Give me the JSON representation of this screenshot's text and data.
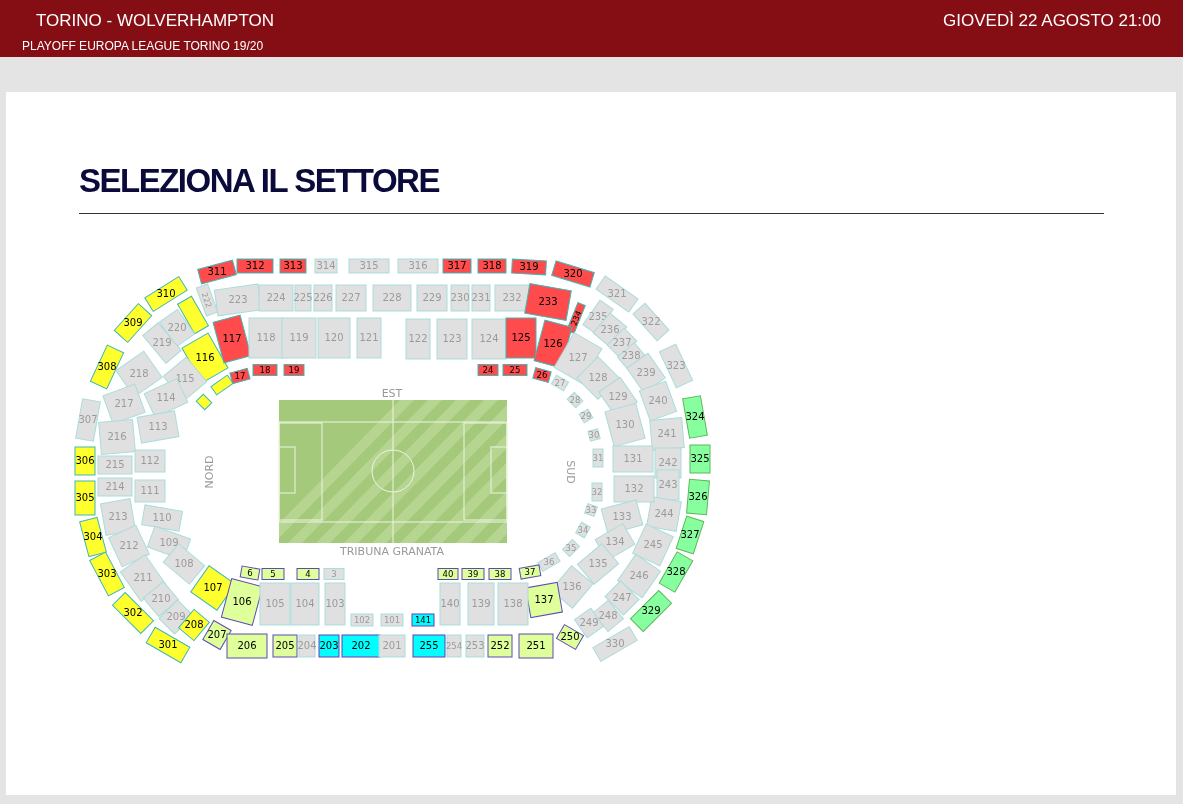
{
  "header": {
    "match": "TORINO - WOLVERHAMPTON",
    "competition": "PLAYOFF EUROPA LEAGUE TORINO 19/20",
    "date": "GIOVEDÌ 22 AGOSTO 21:00"
  },
  "heading": "SELEZIONA IL SETTORE",
  "stadium": {
    "stand_labels": [
      "EST",
      "TRIBUNA GRANATA",
      "NORD",
      "SUD"
    ],
    "sectors": [
      {
        "label": "310",
        "color": "#ffff2e",
        "disabled": false
      },
      {
        "label": "309",
        "color": "#ffff2e",
        "disabled": false
      },
      {
        "label": "308",
        "color": "#ffff2e",
        "disabled": false
      },
      {
        "label": "307",
        "disabled": true
      },
      {
        "label": "306",
        "color": "#ffff2e",
        "disabled": false
      },
      {
        "label": "305",
        "color": "#ffff2e",
        "disabled": false
      },
      {
        "label": "304",
        "color": "#ffff2e",
        "disabled": false
      },
      {
        "label": "303",
        "color": "#ffff2e",
        "disabled": false
      },
      {
        "label": "302",
        "color": "#ffff2e",
        "disabled": false
      },
      {
        "label": "301",
        "color": "#ffff2e",
        "disabled": false
      },
      {
        "label": "311",
        "color": "#ff4b4b",
        "disabled": false
      },
      {
        "label": "312",
        "color": "#ff4b4b",
        "disabled": false
      },
      {
        "label": "313",
        "color": "#ff4b4b",
        "disabled": false
      },
      {
        "label": "314",
        "disabled": true
      },
      {
        "label": "315",
        "disabled": true
      },
      {
        "label": "316",
        "disabled": true
      },
      {
        "label": "317",
        "color": "#ff4b4b",
        "disabled": false
      },
      {
        "label": "318",
        "color": "#ff4b4b",
        "disabled": false
      },
      {
        "label": "319",
        "color": "#ff4b4b",
        "disabled": false
      },
      {
        "label": "320",
        "color": "#ff4b4b",
        "disabled": false
      },
      {
        "label": "321",
        "disabled": true
      },
      {
        "label": "322",
        "disabled": true
      },
      {
        "label": "323",
        "disabled": true
      },
      {
        "label": "324",
        "color": "#88ff9f",
        "disabled": false
      },
      {
        "label": "325",
        "color": "#88ff9f",
        "disabled": false
      },
      {
        "label": "326",
        "color": "#88ff9f",
        "disabled": false
      },
      {
        "label": "327",
        "color": "#88ff9f",
        "disabled": false
      },
      {
        "label": "328",
        "color": "#88ff9f",
        "disabled": false
      },
      {
        "label": "329",
        "color": "#88ff9f",
        "disabled": false
      },
      {
        "label": "330",
        "disabled": true
      },
      {
        "color": "#ffff2e",
        "disabled": false
      },
      {
        "label": "220",
        "disabled": true
      },
      {
        "label": "219",
        "disabled": true
      },
      {
        "label": "218",
        "disabled": true
      },
      {
        "label": "217",
        "disabled": true
      },
      {
        "label": "216",
        "disabled": true
      },
      {
        "label": "215",
        "disabled": true
      },
      {
        "label": "214",
        "disabled": true
      },
      {
        "label": "213",
        "disabled": true
      },
      {
        "label": "212",
        "disabled": true
      },
      {
        "label": "211",
        "disabled": true
      },
      {
        "label": "210",
        "disabled": true
      },
      {
        "label": "209",
        "disabled": true
      },
      {
        "label": "208",
        "color": "#ffff2e",
        "disabled": false
      },
      {
        "label": "207",
        "color": "#deff99",
        "disabled": false
      },
      {
        "label": "222",
        "disabled": true
      },
      {
        "label": "223",
        "disabled": true
      },
      {
        "label": "224",
        "disabled": true
      },
      {
        "label": "225",
        "disabled": true
      },
      {
        "label": "226",
        "disabled": true
      },
      {
        "label": "227",
        "disabled": true
      },
      {
        "label": "228",
        "disabled": true
      },
      {
        "label": "229",
        "disabled": true
      },
      {
        "label": "230",
        "disabled": true
      },
      {
        "label": "231",
        "disabled": true
      },
      {
        "label": "232",
        "disabled": true
      },
      {
        "label": "233",
        "color": "#ff4b4b",
        "disabled": false
      },
      {
        "label": "234",
        "color": "#ff4b4b",
        "disabled": false
      },
      {
        "label": "235",
        "disabled": true
      },
      {
        "label": "236",
        "disabled": true
      },
      {
        "label": "237",
        "disabled": true
      },
      {
        "label": "238",
        "disabled": true
      },
      {
        "label": "239",
        "disabled": true
      },
      {
        "label": "240",
        "disabled": true
      },
      {
        "label": "241",
        "disabled": true
      },
      {
        "label": "242",
        "disabled": true
      },
      {
        "label": "243",
        "disabled": true
      },
      {
        "label": "244",
        "disabled": true
      },
      {
        "label": "245",
        "disabled": true
      },
      {
        "label": "246",
        "disabled": true
      },
      {
        "label": "247",
        "disabled": true
      },
      {
        "label": "248",
        "disabled": true
      },
      {
        "label": "249",
        "disabled": true
      },
      {
        "label": "250",
        "color": "#deff99",
        "disabled": false
      },
      {
        "label": "206",
        "color": "#deff99",
        "disabled": false
      },
      {
        "label": "205",
        "color": "#deff99",
        "disabled": false
      },
      {
        "label": "204",
        "disabled": true
      },
      {
        "label": "203",
        "color": "#00ffff",
        "disabled": false
      },
      {
        "label": "202",
        "color": "#00ffff",
        "disabled": false
      },
      {
        "label": "201",
        "disabled": true
      },
      {
        "label": "255",
        "color": "#00ffff",
        "disabled": false
      },
      {
        "label": "254",
        "disabled": true
      },
      {
        "label": "253",
        "disabled": true
      },
      {
        "label": "252",
        "color": "#deff99",
        "disabled": false
      },
      {
        "label": "251",
        "color": "#deff99",
        "disabled": false
      },
      {
        "label": "116",
        "color": "#ffff2e",
        "disabled": false
      },
      {
        "label": "115",
        "disabled": true
      },
      {
        "label": "114",
        "disabled": true
      },
      {
        "label": "113",
        "disabled": true
      },
      {
        "label": "112",
        "disabled": true
      },
      {
        "label": "111",
        "disabled": true
      },
      {
        "label": "110",
        "disabled": true
      },
      {
        "label": "109",
        "disabled": true
      },
      {
        "label": "108",
        "disabled": true
      },
      {
        "label": "107",
        "color": "#ffff2e",
        "disabled": false
      },
      {
        "label": "106",
        "color": "#deff99",
        "disabled": false
      },
      {
        "label": "117",
        "color": "#ff4b4b",
        "disabled": false
      },
      {
        "label": "118",
        "disabled": true
      },
      {
        "label": "119",
        "disabled": true
      },
      {
        "label": "120",
        "disabled": true
      },
      {
        "label": "121",
        "disabled": true
      },
      {
        "label": "122",
        "disabled": true
      },
      {
        "label": "123",
        "disabled": true
      },
      {
        "label": "124",
        "disabled": true
      },
      {
        "label": "125",
        "color": "#ff4b4b",
        "disabled": false
      },
      {
        "label": "126",
        "color": "#ff4b4b",
        "disabled": false
      },
      {
        "label": "127",
        "disabled": true
      },
      {
        "label": "128",
        "disabled": true
      },
      {
        "label": "129",
        "disabled": true
      },
      {
        "label": "130",
        "disabled": true
      },
      {
        "label": "131",
        "disabled": true
      },
      {
        "label": "132",
        "disabled": true
      },
      {
        "label": "133",
        "disabled": true
      },
      {
        "label": "134",
        "disabled": true
      },
      {
        "label": "135",
        "disabled": true
      },
      {
        "label": "136",
        "disabled": true
      },
      {
        "label": "137",
        "color": "#deff99",
        "disabled": false
      },
      {
        "label": "105",
        "disabled": true
      },
      {
        "label": "104",
        "disabled": true
      },
      {
        "label": "103",
        "disabled": true
      },
      {
        "label": "102",
        "disabled": true
      },
      {
        "label": "101",
        "disabled": true
      },
      {
        "label": "141",
        "color": "#00ffff",
        "disabled": false
      },
      {
        "label": "140",
        "disabled": true
      },
      {
        "label": "139",
        "disabled": true
      },
      {
        "label": "138",
        "disabled": true
      },
      {
        "color": "#ffff2e",
        "disabled": false
      },
      {
        "color": "#ffff2e",
        "disabled": false
      },
      {
        "label": "17",
        "color": "#ff4b4b",
        "disabled": false
      },
      {
        "label": "18",
        "color": "#ff4b4b",
        "disabled": false
      },
      {
        "label": "19",
        "color": "#ff4b4b",
        "disabled": false
      },
      {
        "label": "24",
        "color": "#ff4b4b",
        "disabled": false
      },
      {
        "label": "25",
        "color": "#ff4b4b",
        "disabled": false
      },
      {
        "label": "26",
        "color": "#ff4b4b",
        "disabled": false
      },
      {
        "label": "27",
        "disabled": true
      },
      {
        "label": "28",
        "disabled": true
      },
      {
        "label": "29",
        "disabled": true
      },
      {
        "label": "30",
        "disabled": true
      },
      {
        "label": "31",
        "disabled": true
      },
      {
        "label": "32",
        "disabled": true
      },
      {
        "label": "33",
        "disabled": true
      },
      {
        "label": "34",
        "disabled": true
      },
      {
        "label": "35",
        "disabled": true
      },
      {
        "label": "36",
        "disabled": true
      },
      {
        "label": "6",
        "color": "#deff99",
        "disabled": false
      },
      {
        "label": "5",
        "color": "#deff99",
        "disabled": false
      },
      {
        "label": "4",
        "color": "#deff99",
        "disabled": false
      },
      {
        "label": "3",
        "disabled": true
      },
      {
        "label": "40",
        "color": "#deff99",
        "disabled": false
      },
      {
        "label": "39",
        "color": "#deff99",
        "disabled": false
      },
      {
        "label": "38",
        "color": "#deff99",
        "disabled": false
      },
      {
        "label": "37",
        "color": "#deff99",
        "disabled": false
      }
    ]
  }
}
